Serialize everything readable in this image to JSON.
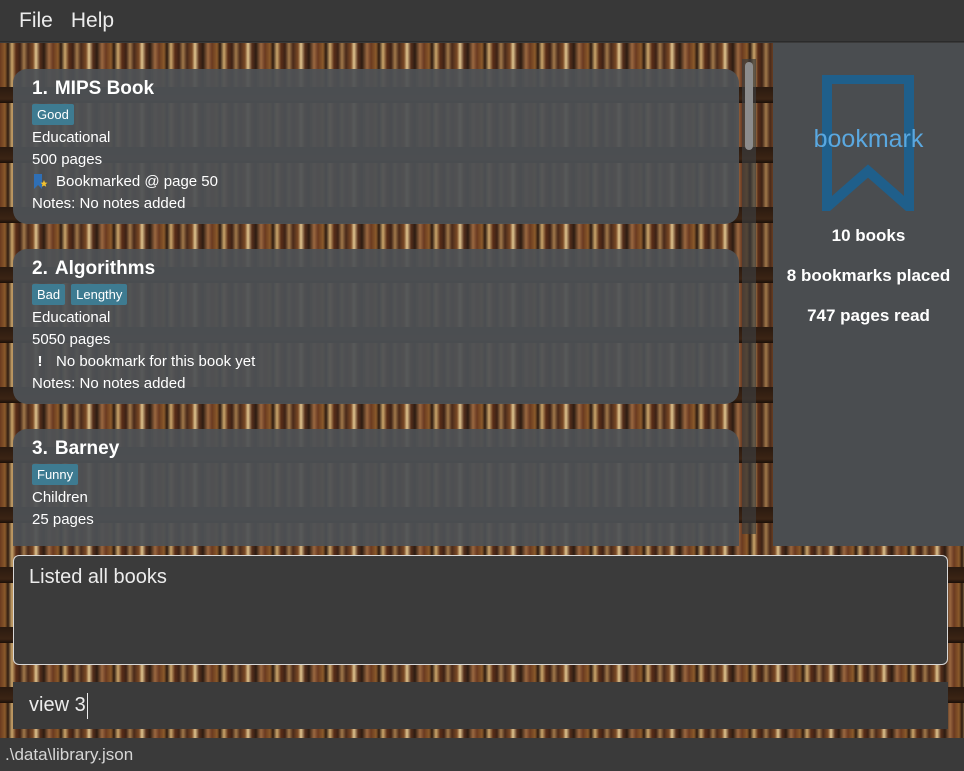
{
  "menu": {
    "file_label": "File",
    "help_label": "Help"
  },
  "books": [
    {
      "index": "1.",
      "title": "MIPS Book",
      "tags": [
        "Good"
      ],
      "genre": "Educational",
      "pages": "500 pages",
      "bookmark_icon": "bookmark-star-icon",
      "bookmark_text": "Bookmarked @ page 50",
      "notes": "Notes: No notes added"
    },
    {
      "index": "2.",
      "title": "Algorithms",
      "tags": [
        "Bad",
        "Lengthy"
      ],
      "genre": "Educational",
      "pages": "5050 pages",
      "bookmark_icon": "exclamation-icon",
      "bookmark_text": "No bookmark for this book yet",
      "notes": "Notes: No notes added"
    },
    {
      "index": "3.",
      "title": "Barney",
      "tags": [
        "Funny"
      ],
      "genre": "Children",
      "pages": "25 pages"
    }
  ],
  "stats": {
    "logo_text": "bookmark",
    "books_count": "10 books",
    "bookmarks_placed": "8 bookmarks placed",
    "pages_read": "747 pages read"
  },
  "result": {
    "message": "Listed all books"
  },
  "command": {
    "value": "view 3"
  },
  "status": {
    "file_path": ".\\data\\library.json"
  },
  "colors": {
    "tag": "#3e7b91",
    "logo_blue": "#5aa8e0",
    "logo_dark_blue": "#1f5f8b",
    "card_bg": "#4e5256",
    "panel_bg": "#4a4d50"
  }
}
